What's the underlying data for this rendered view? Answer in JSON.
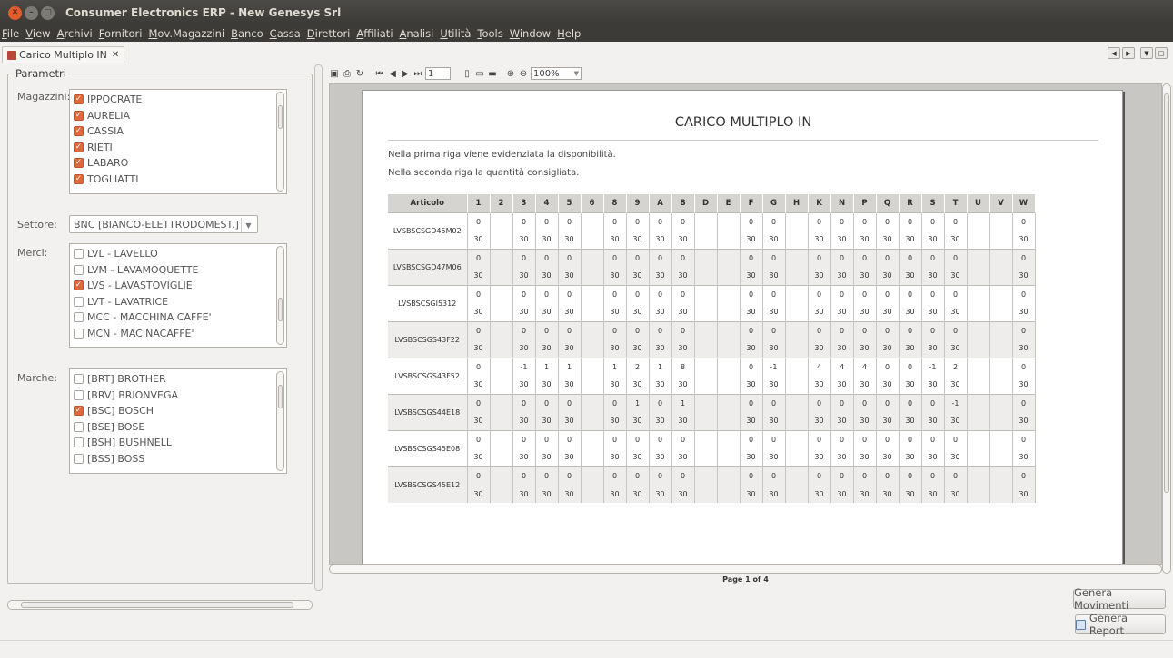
{
  "window": {
    "title": "Consumer Electronics ERP - New Genesys Srl"
  },
  "menu": [
    "File",
    "View",
    "Archivi",
    "Fornitori",
    "Mov.Magazzini",
    "Banco",
    "Cassa",
    "Direttori",
    "Affiliati",
    "Analisi",
    "Utilità",
    "Tools",
    "Window",
    "Help"
  ],
  "tab": {
    "label": "Carico Multiplo IN"
  },
  "params": {
    "legend": "Parametri",
    "magazzini_label": "Magazzini:",
    "magazzini": [
      {
        "label": "IPPOCRATE",
        "checked": true
      },
      {
        "label": "AURELIA",
        "checked": true
      },
      {
        "label": "CASSIA",
        "checked": true
      },
      {
        "label": "RIETI",
        "checked": true
      },
      {
        "label": "LABARO",
        "checked": true
      },
      {
        "label": "TOGLIATTI",
        "checked": true
      }
    ],
    "settore_label": "Settore:",
    "settore_value": "BNC  [BIANCO-ELETTRODOMEST.]",
    "merci_label": "Merci:",
    "merci": [
      {
        "label": "LVL - LAVELLO",
        "checked": false
      },
      {
        "label": "LVM - LAVAMOQUETTE",
        "checked": false
      },
      {
        "label": "LVS - LAVASTOVIGLIE",
        "checked": true
      },
      {
        "label": "LVT - LAVATRICE",
        "checked": false
      },
      {
        "label": "MCC - MACCHINA CAFFE'",
        "checked": false
      },
      {
        "label": "MCN - MACINACAFFE'",
        "checked": false
      }
    ],
    "marche_label": "Marche:",
    "marche": [
      {
        "label": "[BRT] BROTHER",
        "checked": false
      },
      {
        "label": "[BRV] BRIONVEGA",
        "checked": false
      },
      {
        "label": "[BSC] BOSCH",
        "checked": true
      },
      {
        "label": "[BSE] BOSE",
        "checked": false
      },
      {
        "label": "[BSH] BUSHNELL",
        "checked": false
      },
      {
        "label": "[BSS] BOSS",
        "checked": false
      }
    ]
  },
  "viewer": {
    "page_field": "1",
    "zoom": "100%",
    "page_info": "Page 1 of 4"
  },
  "report": {
    "title": "CARICO MULTIPLO IN",
    "note1": "Nella prima riga viene evidenziata la disponibilità.",
    "note2": "Nella seconda riga la quantità consigliata.",
    "columns": [
      "Articolo",
      "1",
      "2",
      "3",
      "4",
      "5",
      "6",
      "8",
      "9",
      "A",
      "B",
      "D",
      "E",
      "F",
      "G",
      "H",
      "K",
      "N",
      "P",
      "Q",
      "R",
      "S",
      "T",
      "U",
      "V",
      "W"
    ],
    "rows": [
      {
        "articolo": "LVSBSCSGD45M02",
        "disp": [
          "0",
          "",
          "0",
          "0",
          "0",
          "",
          "0",
          "0",
          "0",
          "0",
          "",
          "",
          "0",
          "0",
          "",
          "0",
          "0",
          "0",
          "0",
          "0",
          "0",
          "0",
          "",
          "",
          "0"
        ],
        "cons": [
          "30",
          "",
          "30",
          "30",
          "30",
          "",
          "30",
          "30",
          "30",
          "30",
          "",
          "",
          "30",
          "30",
          "",
          "30",
          "30",
          "30",
          "30",
          "30",
          "30",
          "30",
          "",
          "",
          "30"
        ]
      },
      {
        "articolo": "LVSBSCSGD47M06",
        "disp": [
          "0",
          "",
          "0",
          "0",
          "0",
          "",
          "0",
          "0",
          "0",
          "0",
          "",
          "",
          "0",
          "0",
          "",
          "0",
          "0",
          "0",
          "0",
          "0",
          "0",
          "0",
          "",
          "",
          "0"
        ],
        "cons": [
          "30",
          "",
          "30",
          "30",
          "30",
          "",
          "30",
          "30",
          "30",
          "30",
          "",
          "",
          "30",
          "30",
          "",
          "30",
          "30",
          "30",
          "30",
          "30",
          "30",
          "30",
          "",
          "",
          "30"
        ]
      },
      {
        "articolo": "LVSBSCSGI5312",
        "disp": [
          "0",
          "",
          "0",
          "0",
          "0",
          "",
          "0",
          "0",
          "0",
          "0",
          "",
          "",
          "0",
          "0",
          "",
          "0",
          "0",
          "0",
          "0",
          "0",
          "0",
          "0",
          "",
          "",
          "0"
        ],
        "cons": [
          "30",
          "",
          "30",
          "30",
          "30",
          "",
          "30",
          "30",
          "30",
          "30",
          "",
          "",
          "30",
          "30",
          "",
          "30",
          "30",
          "30",
          "30",
          "30",
          "30",
          "30",
          "",
          "",
          "30"
        ]
      },
      {
        "articolo": "LVSBSCSGS43F22",
        "disp": [
          "0",
          "",
          "0",
          "0",
          "0",
          "",
          "0",
          "0",
          "0",
          "0",
          "",
          "",
          "0",
          "0",
          "",
          "0",
          "0",
          "0",
          "0",
          "0",
          "0",
          "0",
          "",
          "",
          "0"
        ],
        "cons": [
          "30",
          "",
          "30",
          "30",
          "30",
          "",
          "30",
          "30",
          "30",
          "30",
          "",
          "",
          "30",
          "30",
          "",
          "30",
          "30",
          "30",
          "30",
          "30",
          "30",
          "30",
          "",
          "",
          "30"
        ]
      },
      {
        "articolo": "LVSBSCSGS43F52",
        "disp": [
          "0",
          "",
          "-1",
          "1",
          "1",
          "",
          "1",
          "2",
          "1",
          "8",
          "",
          "",
          "0",
          "-1",
          "",
          "4",
          "4",
          "4",
          "0",
          "0",
          "-1",
          "2",
          "",
          "",
          "0"
        ],
        "cons": [
          "30",
          "",
          "30",
          "30",
          "30",
          "",
          "30",
          "30",
          "30",
          "30",
          "",
          "",
          "30",
          "30",
          "",
          "30",
          "30",
          "30",
          "30",
          "30",
          "30",
          "30",
          "",
          "",
          "30"
        ]
      },
      {
        "articolo": "LVSBSCSGS44E18",
        "disp": [
          "0",
          "",
          "0",
          "0",
          "0",
          "",
          "0",
          "1",
          "0",
          "1",
          "",
          "",
          "0",
          "0",
          "",
          "0",
          "0",
          "0",
          "0",
          "0",
          "0",
          "-1",
          "",
          "",
          "0"
        ],
        "cons": [
          "30",
          "",
          "30",
          "30",
          "30",
          "",
          "30",
          "30",
          "30",
          "30",
          "",
          "",
          "30",
          "30",
          "",
          "30",
          "30",
          "30",
          "30",
          "30",
          "30",
          "30",
          "",
          "",
          "30"
        ]
      },
      {
        "articolo": "LVSBSCSGS45E08",
        "disp": [
          "0",
          "",
          "0",
          "0",
          "0",
          "",
          "0",
          "0",
          "0",
          "0",
          "",
          "",
          "0",
          "0",
          "",
          "0",
          "0",
          "0",
          "0",
          "0",
          "0",
          "0",
          "",
          "",
          "0"
        ],
        "cons": [
          "30",
          "",
          "30",
          "30",
          "30",
          "",
          "30",
          "30",
          "30",
          "30",
          "",
          "",
          "30",
          "30",
          "",
          "30",
          "30",
          "30",
          "30",
          "30",
          "30",
          "30",
          "",
          "",
          "30"
        ]
      },
      {
        "articolo": "LVSBSCSGS45E12",
        "disp": [
          "0",
          "",
          "0",
          "0",
          "0",
          "",
          "0",
          "0",
          "0",
          "0",
          "",
          "",
          "0",
          "0",
          "",
          "0",
          "0",
          "0",
          "0",
          "0",
          "0",
          "0",
          "",
          "",
          "0"
        ],
        "cons": [
          "30",
          "",
          "30",
          "30",
          "30",
          "",
          "30",
          "30",
          "30",
          "30",
          "",
          "",
          "30",
          "30",
          "",
          "30",
          "30",
          "30",
          "30",
          "30",
          "30",
          "30",
          "",
          "",
          "30"
        ]
      }
    ]
  },
  "buttons": {
    "genera_movimenti": "Genera Movimenti",
    "genera_report": "Genera Report"
  },
  "colors": {
    "checkbox_on": "#e0683c",
    "titlebar": "#3b3a37"
  }
}
